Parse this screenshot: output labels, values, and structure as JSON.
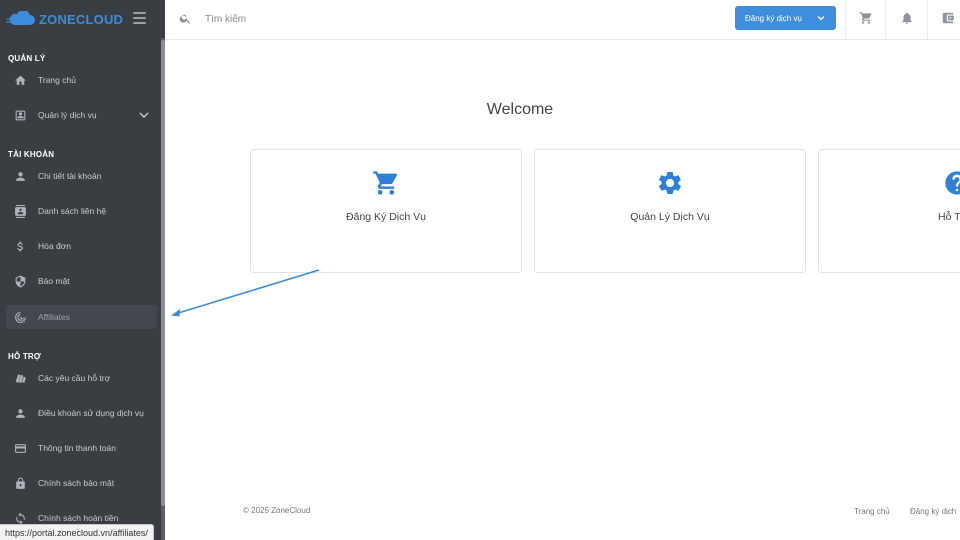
{
  "brand": {
    "zone": "ZONE",
    "cloud": "CLOUD",
    "accent": "#3c8cdc"
  },
  "sidebar": {
    "sections": [
      {
        "title": "QUẢN LÝ"
      },
      {
        "title": "TÀI KHOẢN"
      },
      {
        "title": "HỖ TRỢ"
      }
    ],
    "items": [
      {
        "label": "Trang chủ",
        "icon": "home-icon"
      },
      {
        "label": "Quản lý dịch vụ",
        "icon": "service-box-icon"
      },
      {
        "label": "Chi tiết tài khoản",
        "icon": "person-icon"
      },
      {
        "label": "Danh sách liên hệ",
        "icon": "contacts-icon"
      },
      {
        "label": "Hóa đơn",
        "icon": "dollar-icon"
      },
      {
        "label": "Bảo mật",
        "icon": "shield-icon"
      },
      {
        "label": "Affiliates",
        "icon": "affiliates-icon"
      },
      {
        "label": "Các yêu cầu hỗ trợ",
        "icon": "tickets-icon"
      },
      {
        "label": "Điều khoản sử dụng dịch vụ",
        "icon": "person-icon"
      },
      {
        "label": "Thông tin thanh toán",
        "icon": "credit-card-icon"
      },
      {
        "label": "Chính sách bảo mật",
        "icon": "lock-icon"
      },
      {
        "label": "Chính sách hoàn tiền",
        "icon": "refresh-icon"
      }
    ]
  },
  "topbar": {
    "search_placeholder": "Tìm kiếm",
    "register_button": "Đăng ký dịch vụ"
  },
  "main": {
    "welcome": "Welcome",
    "cards": [
      {
        "label": "Đăng Ký Dịch Vụ",
        "icon": "cart-icon"
      },
      {
        "label": "Quản Lý Dịch Vụ",
        "icon": "gear-icon"
      },
      {
        "label": "Hỗ T",
        "icon": "help-icon"
      }
    ]
  },
  "footer": {
    "copyright": "© 2025 ZoneCloud",
    "links": [
      "Trang chủ",
      "Đăng ký dịch"
    ]
  },
  "statusbar": {
    "url": "https://portal.zonecloud.vn/affiliates/"
  }
}
